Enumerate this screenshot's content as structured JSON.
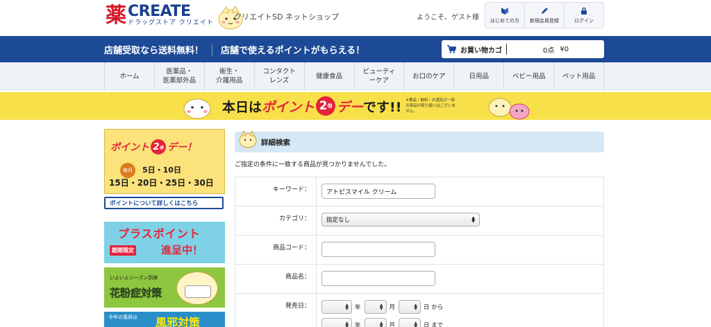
{
  "header": {
    "logo_kanji": "薬",
    "logo_main": "CREATE",
    "logo_sub": "ドラッグストア クリエイト",
    "shop_name": "クリエイトSD ネットショップ",
    "welcome": "ようこそ、ゲスト様",
    "buttons": [
      {
        "label": "はじめての方",
        "icon": "beginner-mark-icon"
      },
      {
        "label": "新規会員登録",
        "icon": "pencil-icon"
      },
      {
        "label": "ログイン",
        "icon": "lock-icon"
      }
    ]
  },
  "promo": {
    "left": "店舗受取なら送料無料！",
    "right": "店舗で使えるポイントがもらえる！"
  },
  "cart": {
    "label": "お買い物カゴ",
    "points": "0点",
    "amount": "¥0"
  },
  "nav": {
    "items": [
      {
        "line1": "ホーム",
        "line2": ""
      },
      {
        "line1": "医薬品・",
        "line2": "医薬部外品"
      },
      {
        "line1": "衛生・",
        "line2": "介護用品"
      },
      {
        "line1": "コンタクト",
        "line2": "レンズ"
      },
      {
        "line1": "健康食品",
        "line2": ""
      },
      {
        "line1": "ビューティ",
        "line2": "ーケア"
      },
      {
        "line1": "お口のケア",
        "line2": ""
      },
      {
        "line1": "日用品",
        "line2": ""
      },
      {
        "line1": "ベビー用品",
        "line2": ""
      },
      {
        "line1": "ペット用品",
        "line2": ""
      }
    ]
  },
  "banner": {
    "part1": "本日は",
    "part2": "ポイント",
    "badge": "2",
    "badge_suffix": "倍",
    "part3": "デー",
    "part4": "です!!",
    "note": "※食品・飲料・お酒及び一部の商品の取り扱いはございません。"
  },
  "sidebar": {
    "point_day": {
      "title_pre": "ポイント",
      "badge": "2",
      "badge_suffix": "倍",
      "title_post": "デー！",
      "month_label": "毎月",
      "dates_line1": "5日・10日",
      "dates_line2": "15日・20日・25日・30日"
    },
    "point_link": "ポイントについて詳しくはこちら",
    "plus_point": {
      "title": "プラスポイント",
      "tag": "期間限定",
      "subtitle": "進呈中！"
    },
    "pollen": {
      "small": "いよいよシーズン到来",
      "title": "花粉症対策"
    },
    "cold": {
      "small": "今年の風邪は",
      "title": "風邪対策"
    }
  },
  "main": {
    "title": "詳細検索",
    "notice": "ご指定の条件に一致する商品が見つかりませんでした。",
    "fields": {
      "keyword_label": "キーワード：",
      "keyword_value": "アトピスマイル クリーム",
      "category_label": "カテゴリ：",
      "category_value": "指定なし",
      "code_label": "商品コード：",
      "code_value": "",
      "name_label": "商品名：",
      "name_value": "",
      "date_label": "発売日：",
      "year_unit": "年",
      "month_unit": "月",
      "day_from": "日 から",
      "day_to": "日 まで"
    }
  },
  "colors": {
    "brand_blue": "#1d4a96",
    "brand_red": "#e3243a",
    "banner_yellow": "#f8e04a",
    "nav_bg": "#eef3f8",
    "section_head_bg": "#d6e7f5"
  }
}
